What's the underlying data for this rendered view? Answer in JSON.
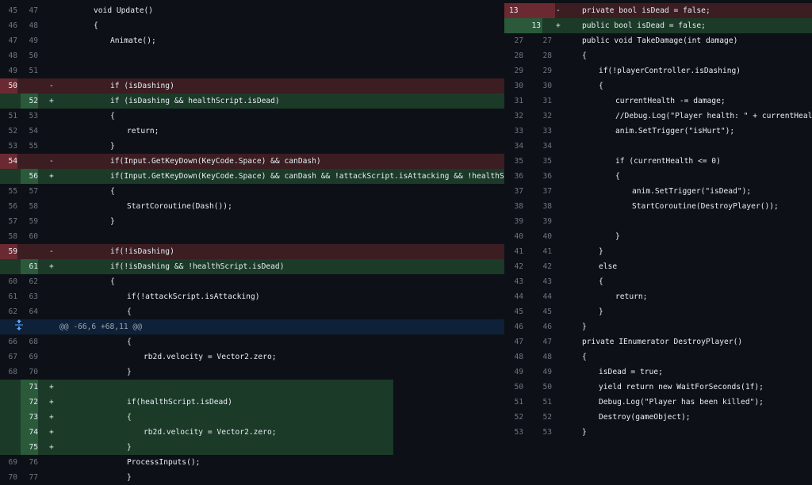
{
  "left_pane": {
    "rows": [
      {
        "type": "ctx",
        "old": "45",
        "new": "47",
        "mark": "",
        "indent": 1,
        "code": "void Update()"
      },
      {
        "type": "ctx",
        "old": "46",
        "new": "48",
        "mark": "",
        "indent": 1,
        "code": "{"
      },
      {
        "type": "ctx",
        "old": "47",
        "new": "49",
        "mark": "",
        "indent": 2,
        "code": "Animate();"
      },
      {
        "type": "ctx",
        "old": "48",
        "new": "50",
        "mark": "",
        "indent": 0,
        "code": ""
      },
      {
        "type": "ctx",
        "old": "49",
        "new": "51",
        "mark": "",
        "indent": 0,
        "code": ""
      },
      {
        "type": "del",
        "old": "50",
        "new": "",
        "mark": "-",
        "indent": 2,
        "code": "if (isDashing)"
      },
      {
        "type": "add",
        "old": "",
        "new": "52",
        "mark": "+",
        "indent": 2,
        "code": "if (isDashing && healthScript.isDead)"
      },
      {
        "type": "ctx",
        "old": "51",
        "new": "53",
        "mark": "",
        "indent": 2,
        "code": "{"
      },
      {
        "type": "ctx",
        "old": "52",
        "new": "54",
        "mark": "",
        "indent": 3,
        "code": "return;"
      },
      {
        "type": "ctx",
        "old": "53",
        "new": "55",
        "mark": "",
        "indent": 2,
        "code": "}"
      },
      {
        "type": "del",
        "old": "54",
        "new": "",
        "mark": "-",
        "indent": 2,
        "code": "if(Input.GetKeyDown(KeyCode.Space) && canDash)"
      },
      {
        "type": "add",
        "old": "",
        "new": "56",
        "mark": "+",
        "indent": 2,
        "code": "if(Input.GetKeyDown(KeyCode.Space) && canDash && !attackScript.isAttacking && !healthScript.isDead)"
      },
      {
        "type": "ctx",
        "old": "55",
        "new": "57",
        "mark": "",
        "indent": 2,
        "code": "{"
      },
      {
        "type": "ctx",
        "old": "56",
        "new": "58",
        "mark": "",
        "indent": 3,
        "code": "StartCoroutine(Dash());"
      },
      {
        "type": "ctx",
        "old": "57",
        "new": "59",
        "mark": "",
        "indent": 2,
        "code": "}"
      },
      {
        "type": "ctx",
        "old": "58",
        "new": "60",
        "mark": "",
        "indent": 0,
        "code": ""
      },
      {
        "type": "del",
        "old": "59",
        "new": "",
        "mark": "-",
        "indent": 2,
        "code": "if(!isDashing)"
      },
      {
        "type": "add",
        "old": "",
        "new": "61",
        "mark": "+",
        "indent": 2,
        "code": "if(!isDashing && !healthScript.isDead)"
      },
      {
        "type": "ctx",
        "old": "60",
        "new": "62",
        "mark": "",
        "indent": 2,
        "code": "{"
      },
      {
        "type": "ctx",
        "old": "61",
        "new": "63",
        "mark": "",
        "indent": 3,
        "code": "if(!attackScript.isAttacking)"
      },
      {
        "type": "ctx",
        "old": "62",
        "new": "64",
        "mark": "",
        "indent": 3,
        "code": "{"
      },
      {
        "type": "hunk",
        "old": "",
        "new": "",
        "mark": "",
        "indent": 0,
        "code": "@@ -66,6 +68,11 @@"
      },
      {
        "type": "ctx",
        "old": "66",
        "new": "68",
        "mark": "",
        "indent": 3,
        "code": "{"
      },
      {
        "type": "ctx",
        "old": "67",
        "new": "69",
        "mark": "",
        "indent": 4,
        "code": "rb2d.velocity = Vector2.zero;"
      },
      {
        "type": "ctx",
        "old": "68",
        "new": "70",
        "mark": "",
        "indent": 3,
        "code": "}"
      },
      {
        "type": "add",
        "old": "",
        "new": "71",
        "mark": "+",
        "indent": 0,
        "code": "",
        "short": true
      },
      {
        "type": "add",
        "old": "",
        "new": "72",
        "mark": "+",
        "indent": 3,
        "code": "if(healthScript.isDead)",
        "short": true
      },
      {
        "type": "add",
        "old": "",
        "new": "73",
        "mark": "+",
        "indent": 3,
        "code": "{",
        "short": true
      },
      {
        "type": "add",
        "old": "",
        "new": "74",
        "mark": "+",
        "indent": 4,
        "code": "rb2d.velocity = Vector2.zero;",
        "short": true
      },
      {
        "type": "add",
        "old": "",
        "new": "75",
        "mark": "+",
        "indent": 3,
        "code": "}",
        "short": true
      },
      {
        "type": "ctx",
        "old": "69",
        "new": "76",
        "mark": "",
        "indent": 3,
        "code": "ProcessInputs();"
      },
      {
        "type": "ctx",
        "old": "70",
        "new": "77",
        "mark": "",
        "indent": 3,
        "code": "}"
      }
    ]
  },
  "right_pane": {
    "rows": [
      {
        "type": "del",
        "old": "13",
        "new": "",
        "mark": "-",
        "indent": 0,
        "code": "private bool isDead = false;"
      },
      {
        "type": "add",
        "old": "",
        "new": "13",
        "mark": "+",
        "indent": 0,
        "code": "public bool isDead = false;"
      },
      {
        "type": "ctx",
        "old": "27",
        "new": "27",
        "mark": "",
        "indent": 0,
        "code": "public void TakeDamage(int damage)"
      },
      {
        "type": "ctx",
        "old": "28",
        "new": "28",
        "mark": "",
        "indent": 0,
        "code": "{"
      },
      {
        "type": "ctx",
        "old": "29",
        "new": "29",
        "mark": "",
        "indent": 1,
        "code": "if(!playerController.isDashing)"
      },
      {
        "type": "ctx",
        "old": "30",
        "new": "30",
        "mark": "",
        "indent": 1,
        "code": "{"
      },
      {
        "type": "ctx",
        "old": "31",
        "new": "31",
        "mark": "",
        "indent": 2,
        "code": "currentHealth -= damage;"
      },
      {
        "type": "ctx",
        "old": "32",
        "new": "32",
        "mark": "",
        "indent": 2,
        "code": "//Debug.Log(\"Player health: \" + currentHealth);"
      },
      {
        "type": "ctx",
        "old": "33",
        "new": "33",
        "mark": "",
        "indent": 2,
        "code": "anim.SetTrigger(\"isHurt\");"
      },
      {
        "type": "ctx",
        "old": "34",
        "new": "34",
        "mark": "",
        "indent": 0,
        "code": ""
      },
      {
        "type": "ctx",
        "old": "35",
        "new": "35",
        "mark": "",
        "indent": 2,
        "code": "if (currentHealth <= 0)"
      },
      {
        "type": "ctx",
        "old": "36",
        "new": "36",
        "mark": "",
        "indent": 2,
        "code": "{"
      },
      {
        "type": "ctx",
        "old": "37",
        "new": "37",
        "mark": "",
        "indent": 3,
        "code": "anim.SetTrigger(\"isDead\");"
      },
      {
        "type": "ctx",
        "old": "38",
        "new": "38",
        "mark": "",
        "indent": 3,
        "code": "StartCoroutine(DestroyPlayer());"
      },
      {
        "type": "ctx",
        "old": "39",
        "new": "39",
        "mark": "",
        "indent": 0,
        "code": ""
      },
      {
        "type": "ctx",
        "old": "40",
        "new": "40",
        "mark": "",
        "indent": 2,
        "code": "}"
      },
      {
        "type": "ctx",
        "old": "41",
        "new": "41",
        "mark": "",
        "indent": 1,
        "code": "}"
      },
      {
        "type": "ctx",
        "old": "42",
        "new": "42",
        "mark": "",
        "indent": 1,
        "code": "else"
      },
      {
        "type": "ctx",
        "old": "43",
        "new": "43",
        "mark": "",
        "indent": 1,
        "code": "{"
      },
      {
        "type": "ctx",
        "old": "44",
        "new": "44",
        "mark": "",
        "indent": 2,
        "code": "return;"
      },
      {
        "type": "ctx",
        "old": "45",
        "new": "45",
        "mark": "",
        "indent": 1,
        "code": "}"
      },
      {
        "type": "ctx",
        "old": "46",
        "new": "46",
        "mark": "",
        "indent": 0,
        "code": "}"
      },
      {
        "type": "ctx",
        "old": "47",
        "new": "47",
        "mark": "",
        "indent": 0,
        "code": "private IEnumerator DestroyPlayer()"
      },
      {
        "type": "ctx",
        "old": "48",
        "new": "48",
        "mark": "",
        "indent": 0,
        "code": "{"
      },
      {
        "type": "ctx",
        "old": "49",
        "new": "49",
        "mark": "",
        "indent": 1,
        "code": "isDead = true;"
      },
      {
        "type": "ctx",
        "old": "50",
        "new": "50",
        "mark": "",
        "indent": 1,
        "code": "yield return new WaitForSeconds(1f);"
      },
      {
        "type": "ctx",
        "old": "51",
        "new": "51",
        "mark": "",
        "indent": 1,
        "code": "Debug.Log(\"Player has been killed\");"
      },
      {
        "type": "ctx",
        "old": "52",
        "new": "52",
        "mark": "",
        "indent": 1,
        "code": "Destroy(gameObject);"
      },
      {
        "type": "ctx",
        "old": "53",
        "new": "53",
        "mark": "",
        "indent": 0,
        "code": "}"
      }
    ]
  },
  "icons": {
    "hunk_expand": "unfold-icon"
  },
  "colors": {
    "background": "#0d1117",
    "deleted_row": "#3b1d22",
    "added_row": "#1b3a28",
    "hunk_row": "#0f2139"
  }
}
